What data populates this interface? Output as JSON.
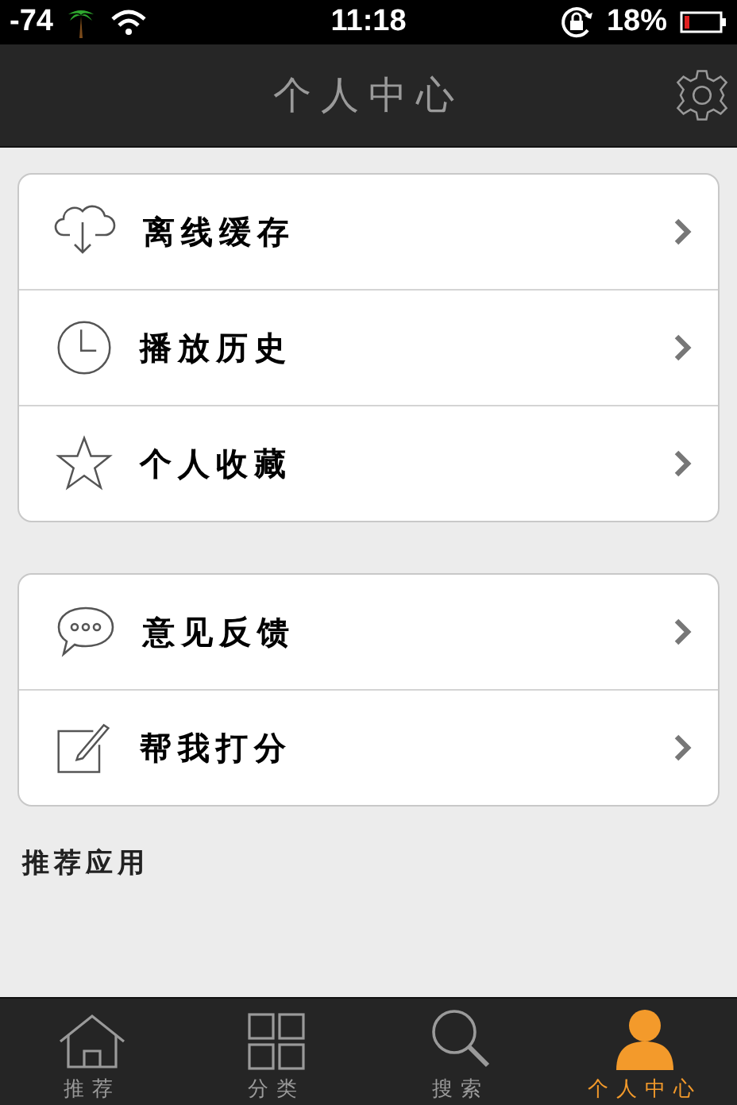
{
  "status_bar": {
    "signal": "-74",
    "time": "11:18",
    "battery": "18%"
  },
  "nav": {
    "title": "个人中心"
  },
  "groups": [
    {
      "items": [
        {
          "kind": "cloud",
          "label": "离线缓存"
        },
        {
          "kind": "clock",
          "label": "播放历史"
        },
        {
          "kind": "star",
          "label": "个人收藏"
        }
      ]
    },
    {
      "items": [
        {
          "kind": "chat",
          "label": "意见反馈"
        },
        {
          "kind": "edit",
          "label": "帮我打分"
        }
      ]
    }
  ],
  "section_title": "推荐应用",
  "tabs": [
    {
      "kind": "home",
      "label": "推荐",
      "selected": false
    },
    {
      "kind": "grid",
      "label": "分类",
      "selected": false
    },
    {
      "kind": "search",
      "label": "搜索",
      "selected": false
    },
    {
      "kind": "person",
      "label": "个人中心",
      "selected": true
    }
  ]
}
